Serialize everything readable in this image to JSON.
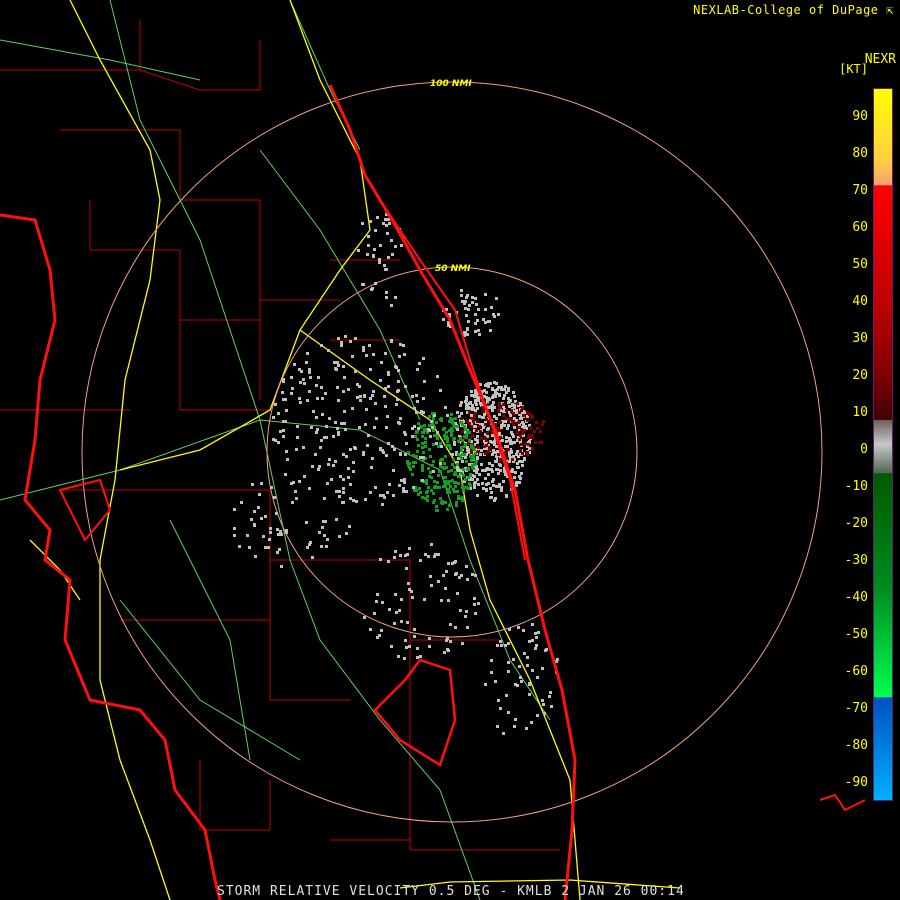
{
  "header": {
    "credit": "NEXLAB-College of DuPage",
    "credit_icon": "arrow-corner-icon",
    "product": "NEXR",
    "unit": "[KT]"
  },
  "legend": {
    "ticks": [
      "90",
      "80",
      "70",
      "60",
      "50",
      "40",
      "30",
      "20",
      "10",
      "0",
      "-10",
      "-20",
      "-30",
      "-40",
      "-50",
      "-60",
      "-70",
      "-80",
      "-90"
    ],
    "tick_values": [
      90,
      80,
      70,
      60,
      50,
      40,
      30,
      20,
      10,
      0,
      -10,
      -20,
      -30,
      -40,
      -50,
      -60,
      -70,
      -80,
      -90
    ],
    "colors": {
      "inbound_max": "#00b0ff",
      "inbound": "#00ff50",
      "near_zero": "#c8c8c8",
      "outbound": "#800000",
      "outbound_max": "#ffff00"
    }
  },
  "map": {
    "rings": [
      {
        "label": "100 NMI",
        "range_nmi": 100
      },
      {
        "label": "50 NMI",
        "range_nmi": 50
      }
    ],
    "colors": {
      "coast": "#ff1010",
      "county": "#c00000",
      "road_major": "#ffff00",
      "road_minor": "#60d060",
      "ring": "#f0a080",
      "echo_zero": "#c0c0c0",
      "echo_in": "#10a020",
      "echo_out": "#800000"
    }
  },
  "caption": "STORM RELATIVE VELOCITY 0.5 DEG - KMLB 2 JAN 26 00:14"
}
